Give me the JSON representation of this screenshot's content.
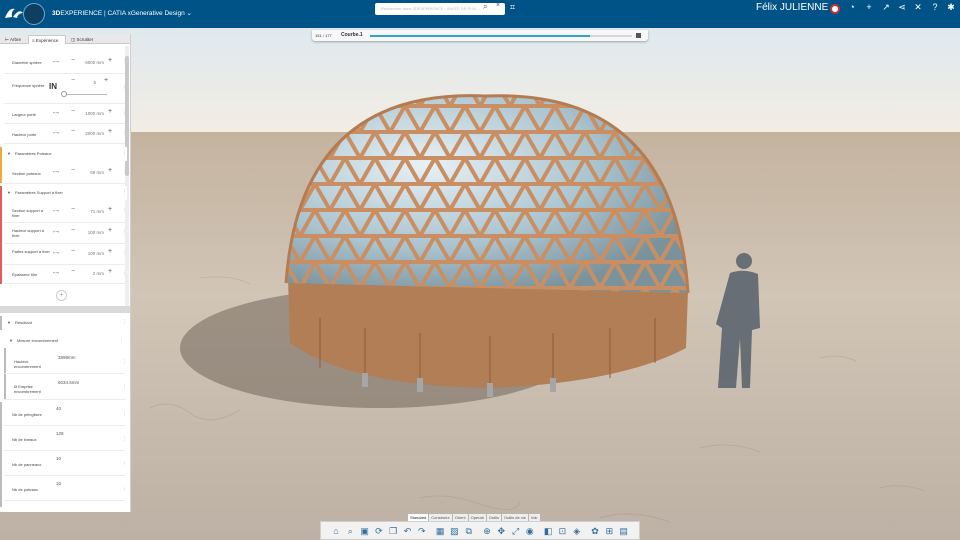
{
  "topbar": {
    "brand_prefix": "3D",
    "brand_rest": "EXPERIENCE | CATIA xGenerative Design",
    "dropdown_icon": "chevron-down-icon",
    "search_placeholder": "Rechercher dans 3DEXPERIENCE / INVITE DE PLM ...",
    "user_name": "Félix JULIENNE",
    "accent": "#005386"
  },
  "curve_slider": {
    "frame": "151 / 177",
    "name": "Courbe.1",
    "progress": 0.84
  },
  "panel": {
    "tabs": [
      "Arbre",
      "Expérience",
      "Scrutiter"
    ],
    "inputs": [
      {
        "label": "Diamètre sphère",
        "value": "6000 mm"
      },
      {
        "label": "Fréquence sphère",
        "value": "5"
      },
      {
        "label": "Largeur porte",
        "value": "1000 mm"
      },
      {
        "label": "Hauteur porte",
        "value": "2000 mm"
      }
    ],
    "section_poteaux": {
      "title": "Paramètres Poteaux",
      "rows": [
        {
          "label": "Section poteaux",
          "value": "69 mm"
        }
      ]
    },
    "section_support": {
      "title": "Paramètres Support à fixer",
      "rows": [
        {
          "label": "Section support à fixer",
          "value": "71 mm"
        },
        {
          "label": "Hauteur support à fixer",
          "value": "100 mm"
        },
        {
          "label": "Pattes support à fixer",
          "value": "100 mm"
        },
        {
          "label": "Épaisseur tôle",
          "value": "2 mm"
        }
      ]
    },
    "section_resultant": {
      "title": "Résultant"
    },
    "section_mesure": {
      "title": "Mesure encombrement",
      "rows": [
        {
          "label": "Hauteur encombrement",
          "value": "3898mm"
        },
        {
          "label": "Ø Emprise encombrement",
          "value": "6034.5mm"
        }
      ]
    },
    "counts": [
      {
        "label": "Nb de péinglises",
        "value": "40"
      },
      {
        "label": "Nb de lineaux",
        "value": "128"
      },
      {
        "label": "Nb de panneaux",
        "value": "10"
      },
      {
        "label": "Nb de poteaux",
        "value": "10"
      }
    ]
  },
  "actionbar": {
    "tabs": [
      "Standard",
      "Construire",
      "Orient",
      "Operati",
      "Outils",
      "Outils de vis",
      "Voir"
    ],
    "active_tab": "Standard",
    "icons": [
      "home-icon",
      "search-icon",
      "save-icon",
      "refresh-icon",
      "copy-icon",
      "undo-icon",
      "redo-icon",
      "grid-icon",
      "image-icon",
      "connector-icon",
      "zoom-icon",
      "move-icon",
      "fit-icon",
      "globe-icon",
      "isolate-icon",
      "lock-icon",
      "paint-icon",
      "render-icon",
      "compass-icon",
      "view-icon"
    ]
  }
}
